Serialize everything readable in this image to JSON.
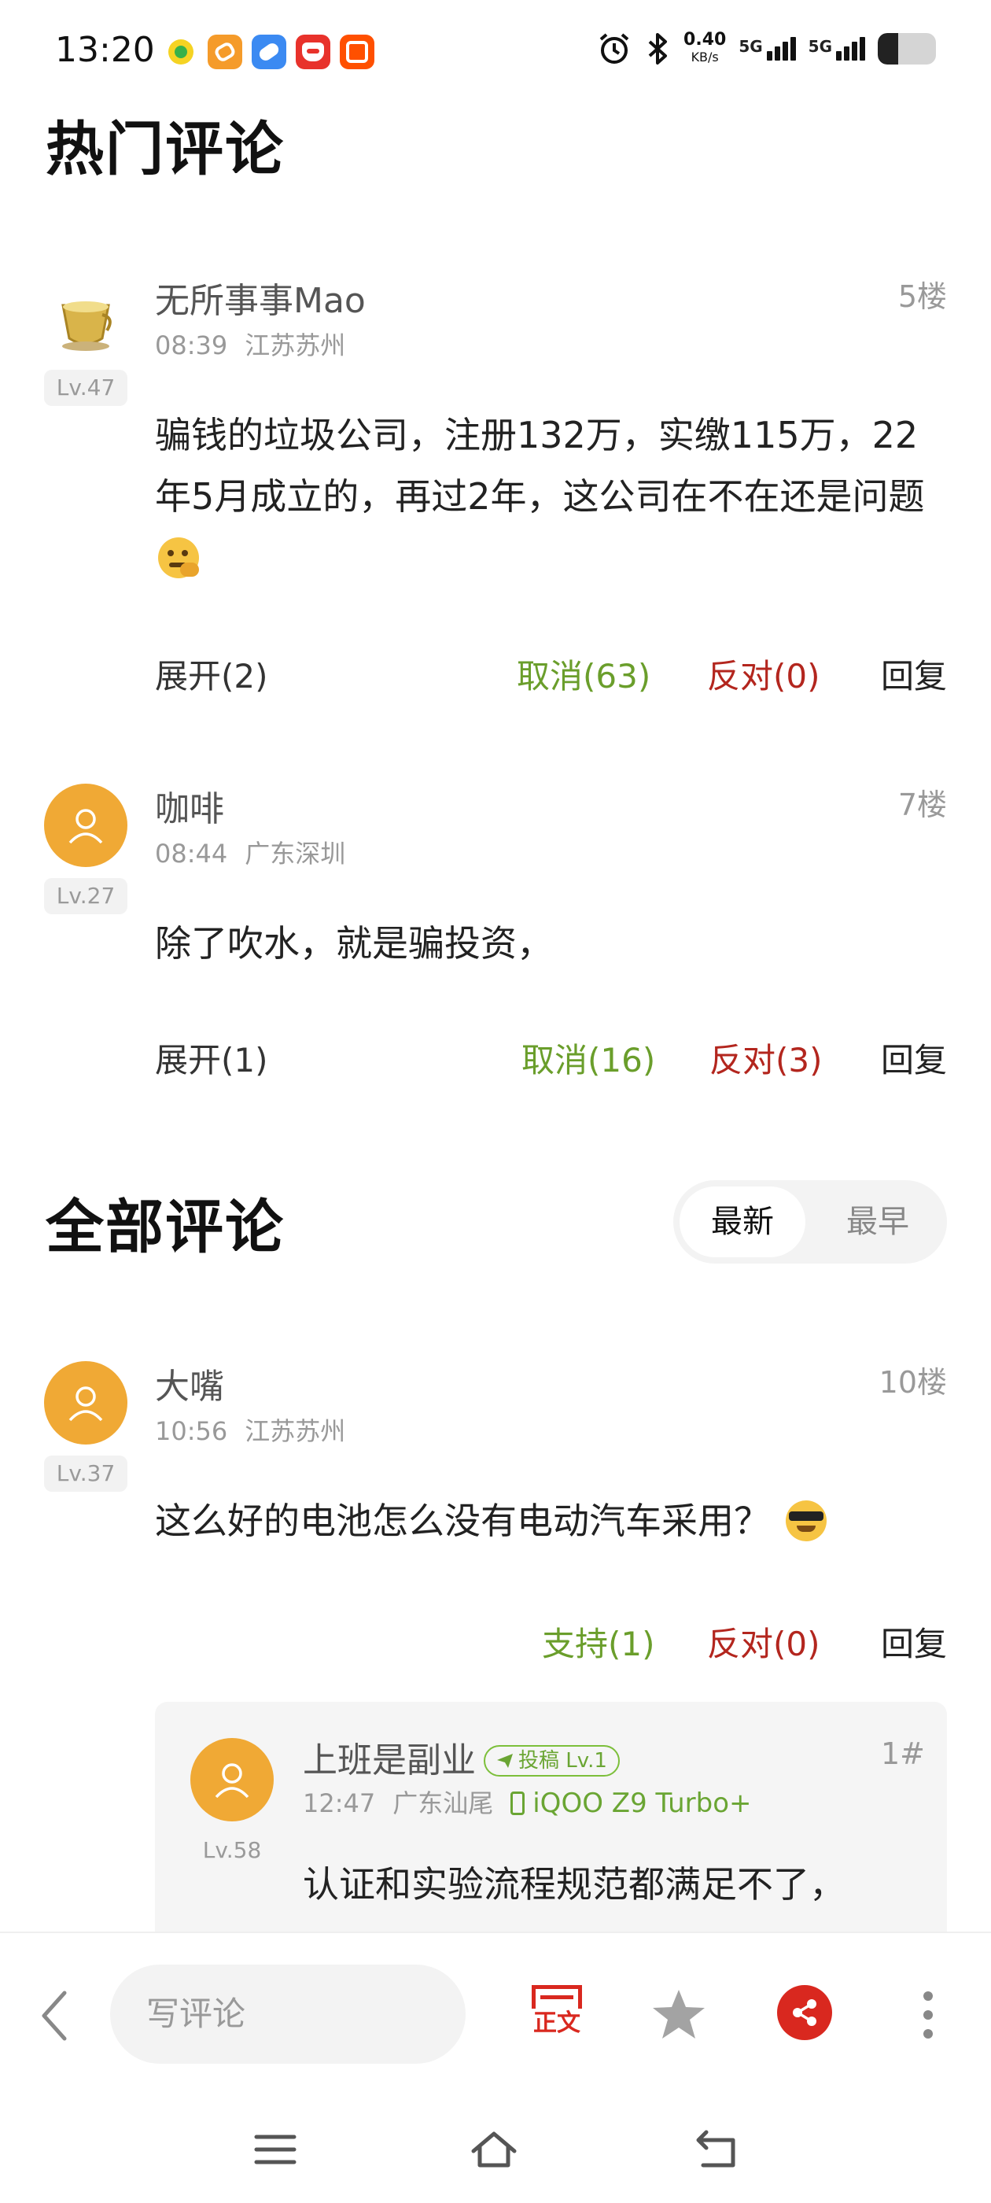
{
  "status_bar": {
    "time": "13:20",
    "net_speed": "0.40",
    "net_unit": "KB/s",
    "sim1": "5G",
    "sim2": "5G",
    "battery_level": 0.35
  },
  "hot_comments": {
    "title": "热门评论",
    "items": [
      {
        "name": "无所事事Mao",
        "time": "08:39",
        "location": "江苏苏州",
        "level": "Lv.47",
        "floor": "5楼",
        "text": "骗钱的垃圾公司，注册132万，实缴115万，22年5月成立的，再过2年，这公司在不在还是问题",
        "expand": "展开(2)",
        "like": "取消(63)",
        "dislike": "反对(0)",
        "reply": "回复"
      },
      {
        "name": "咖啡",
        "time": "08:44",
        "location": "广东深圳",
        "level": "Lv.27",
        "floor": "7楼",
        "text": "除了吹水，就是骗投资，",
        "expand": "展开(1)",
        "like": "取消(16)",
        "dislike": "反对(3)",
        "reply": "回复"
      }
    ]
  },
  "all_comments": {
    "title": "全部评论",
    "sort_options": [
      "最新",
      "最早"
    ],
    "sort_selected": "最新",
    "items": [
      {
        "name": "大嘴",
        "time": "10:56",
        "location": "江苏苏州",
        "level": "Lv.37",
        "floor": "10楼",
        "text": "这么好的电池怎么没有电动汽车采用？",
        "like": "支持(1)",
        "dislike": "反对(0)",
        "reply": "回复",
        "nested_reply": {
          "name": "上班是副业",
          "badge": "投稿 Lv.1",
          "time": "12:47",
          "location": "广东汕尾",
          "device": "iQOO Z9 Turbo+",
          "level": "Lv.58",
          "floor": "1#",
          "text": "认证和实验流程规范都满足不了，"
        }
      }
    ]
  },
  "toolbar": {
    "comment_placeholder": "写评论",
    "zhengwen_label": "正文"
  },
  "colors": {
    "like_green": "#6a9e2b",
    "dislike_red": "#b3261e",
    "avatar_orange": "#f0a935",
    "share_red": "#d9281f"
  }
}
